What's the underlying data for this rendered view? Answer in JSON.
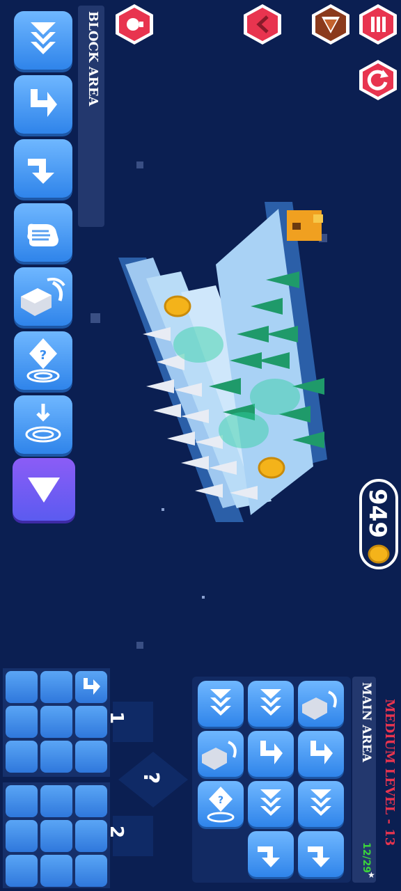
{
  "block_area": {
    "label": "BLOCK AREA",
    "blocks": [
      {
        "icon": "move-down-icon"
      },
      {
        "icon": "turn-left-icon"
      },
      {
        "icon": "turn-right-icon"
      },
      {
        "icon": "hand-stop-icon"
      },
      {
        "icon": "rotate-block-icon"
      },
      {
        "icon": "mystery-portal-icon"
      },
      {
        "icon": "portal-drop-icon"
      },
      {
        "icon": "play-icon"
      }
    ]
  },
  "top_controls": {
    "hint": "lightbulb-icon",
    "back": "chevron-left-icon",
    "character": "fox-avatar-icon",
    "menu": "menu-bars-icon",
    "restart": "restart-icon"
  },
  "coins": {
    "value": "949"
  },
  "main_area": {
    "label": "MAIN AREA",
    "level": "MEDIUM LEVEL - 13",
    "counter": "12/29",
    "star": "★"
  },
  "functions": {
    "f1": "1",
    "f2": "2",
    "mystery": "?"
  },
  "colors": {
    "accent": "#e8344f",
    "bg": "#0b1f52",
    "block": "#3b8ff0",
    "counter": "#3bd43b"
  }
}
